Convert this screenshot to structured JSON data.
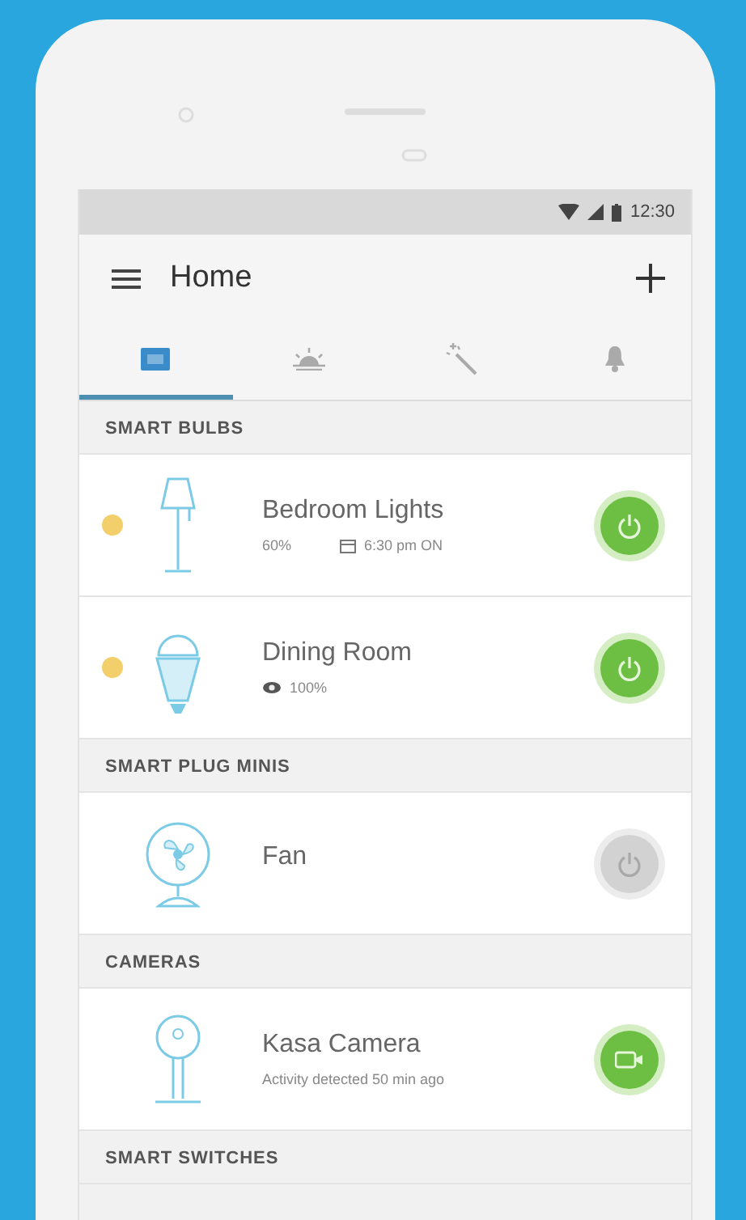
{
  "status_bar": {
    "time": "12:30"
  },
  "app_bar": {
    "title": "Home"
  },
  "tabs": [
    {
      "selected": true
    },
    {
      "selected": false
    },
    {
      "selected": false
    },
    {
      "selected": false
    }
  ],
  "sections": [
    {
      "title": "SMART BULBS",
      "devices": [
        {
          "kind": "lamp",
          "name": "Bedroom Lights",
          "color": "#f2cf6a",
          "on": true,
          "details": [
            {
              "kind": "text",
              "text": "60%"
            },
            {
              "kind": "schedule",
              "text": "6:30 pm ON"
            }
          ]
        },
        {
          "kind": "bulb",
          "name": "Dining Room",
          "color": "#f2cf6a",
          "on": true,
          "details": [
            {
              "kind": "brightness",
              "text": "100%"
            }
          ]
        }
      ]
    },
    {
      "title": "SMART PLUG MINIS",
      "devices": [
        {
          "kind": "fan",
          "name": "Fan",
          "on": false
        }
      ]
    },
    {
      "title": "CAMERAS",
      "devices": [
        {
          "kind": "camera",
          "name": "Kasa Camera",
          "on": true,
          "details": [
            {
              "kind": "text",
              "text": "Activity detected 50 min ago"
            }
          ]
        }
      ]
    },
    {
      "title": "SMART SWITCHES"
    }
  ]
}
